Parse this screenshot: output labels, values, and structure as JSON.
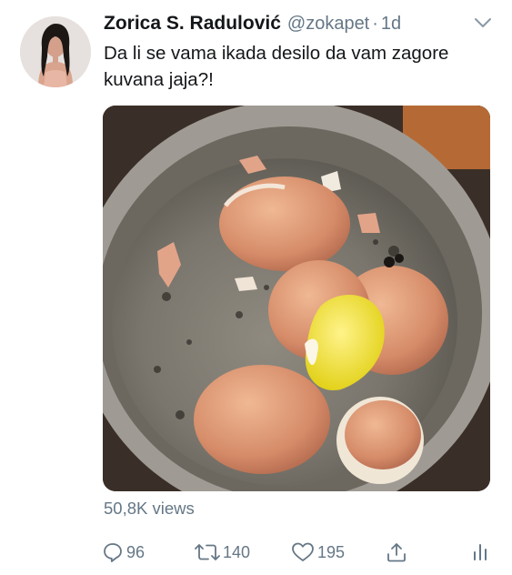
{
  "tweet": {
    "author_name": "Zorica S. Radulović",
    "handle": "@zokapet",
    "separator": "·",
    "time": "1d",
    "text": "Da li se vama ikada desilo da vam zagore kuvana jaja?!",
    "views": "50,8K views"
  },
  "actions": {
    "replies": "96",
    "retweets": "140",
    "likes": "195"
  },
  "icons": {
    "reply": "reply-icon",
    "retweet": "retweet-icon",
    "like": "heart-icon",
    "share": "share-icon",
    "analytics": "analytics-icon",
    "menu": "chevron-down-icon"
  },
  "colors": {
    "text": "#14171a",
    "secondary": "#657786"
  }
}
